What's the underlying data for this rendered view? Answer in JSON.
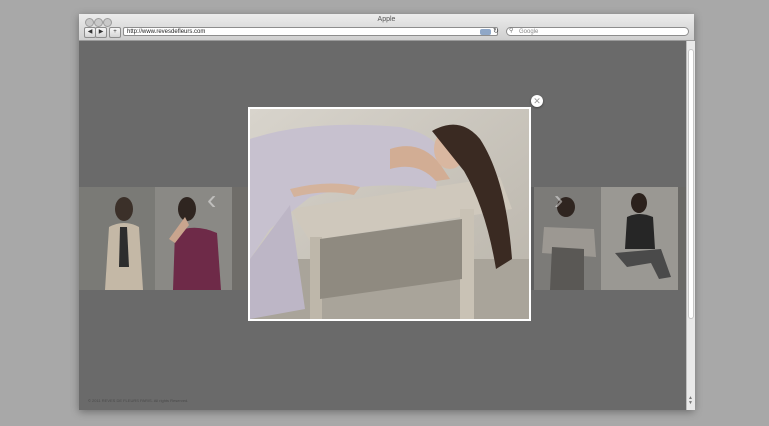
{
  "window": {
    "title": "Apple",
    "url": "http://www.revesdefleurs.com",
    "search_placeholder": "Google",
    "back_icon": "◀",
    "forward_icon": "▶",
    "add_icon": "+",
    "reload_icon": "↻",
    "magnifier_icon": "⚲"
  },
  "gallery": {
    "prev_icon": "‹",
    "next_icon": "›"
  },
  "modal": {
    "close_icon": "✕"
  },
  "footer": {
    "copyright": "© 2011 REVES DE FLEURS PARIS. All rights Reserved."
  }
}
